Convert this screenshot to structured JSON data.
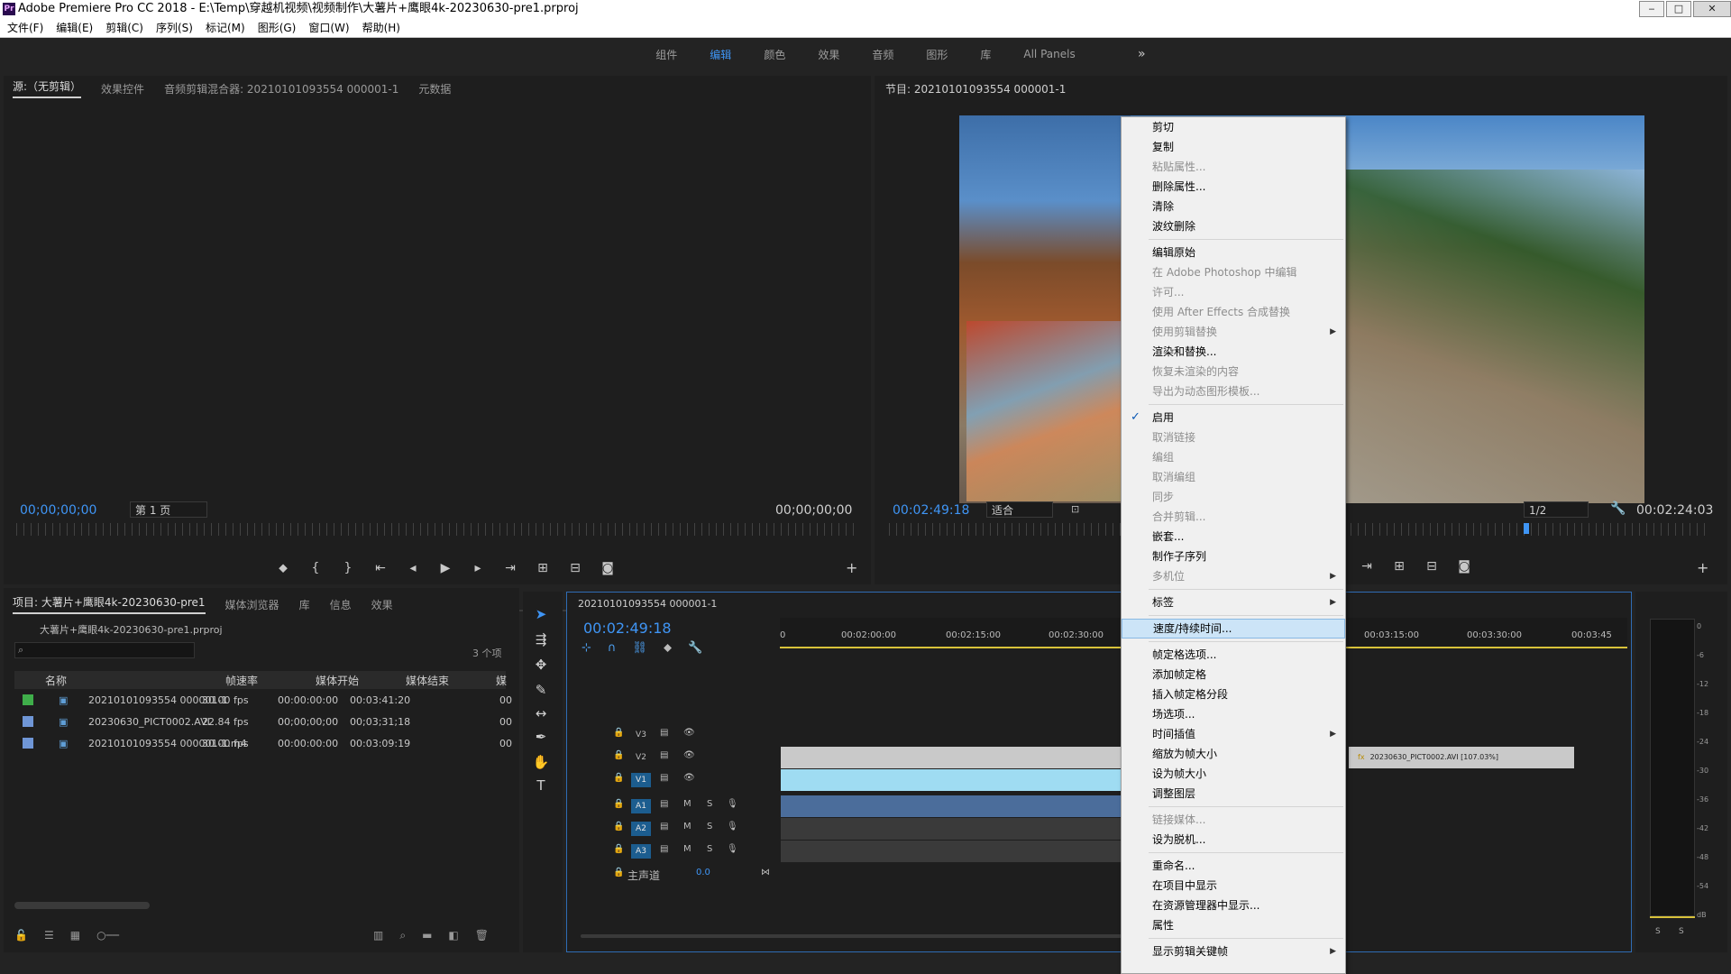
{
  "window": {
    "title": "Adobe Premiere Pro CC 2018 - E:\\Temp\\穿越机视频\\视频制作\\大薯片+鹰眼4k-20230630-pre1.prproj",
    "logo": "Pr"
  },
  "menubar": [
    "文件(F)",
    "编辑(E)",
    "剪辑(C)",
    "序列(S)",
    "标记(M)",
    "图形(G)",
    "窗口(W)",
    "帮助(H)"
  ],
  "workspaces": {
    "items": [
      "组件",
      "编辑",
      "颜色",
      "效果",
      "音频",
      "图形",
      "库",
      "All Panels"
    ],
    "active": "编辑",
    "more": "»"
  },
  "source_panel": {
    "tabs": [
      "源:（无剪辑）",
      "效果控件",
      "音频剪辑混合器: 20210101093554 000001-1",
      "元数据"
    ],
    "timecode_left": "00;00;00;00",
    "page_select": "第 1 页",
    "timecode_right": "00;00;00;00"
  },
  "program_panel": {
    "tab": "节目: 20210101093554 000001-1",
    "timecode_left": "00:02:49:18",
    "fit_select": "适合",
    "resolution_select": "1/2",
    "timecode_right": "00:02:24:03"
  },
  "project_panel": {
    "tabs": [
      "项目: 大薯片+鹰眼4k-20230630-pre1",
      "媒体浏览器",
      "库",
      "信息",
      "效果"
    ],
    "file": "大薯片+鹰眼4k-20230630-pre1.prproj",
    "count": "3 个项",
    "columns": [
      "名称",
      "帧速率",
      "媒体开始",
      "媒体结束",
      "媒"
    ],
    "rows": [
      {
        "color": "#3fae4a",
        "name": "20210101093554 000001-1",
        "fps": "30.00 fps",
        "start": "00:00:00:00",
        "end": "00:03:41:20",
        "extra": "00"
      },
      {
        "color": "#6f96d6",
        "name": "20230630_PICT0002.AVI",
        "fps": "22.84 fps",
        "start": "00;00;00;00",
        "end": "00;03;31;18",
        "extra": "00"
      },
      {
        "color": "#6f96d6",
        "name": "20210101093554 000001-1.m4",
        "fps": "30.00 fps",
        "start": "00:00:00:00",
        "end": "00:03:09:19",
        "extra": "00"
      }
    ]
  },
  "timeline": {
    "tab": "20210101093554 000001-1",
    "timecode": "00:02:49:18",
    "ruler_left": [
      "0",
      "00:02:00:00",
      "00:02:15:00",
      "00:02:30:00"
    ],
    "ruler_right": [
      "00:03:15:00",
      "00:03:30:00",
      "00:03:45"
    ],
    "tracks": [
      "V3",
      "V2",
      "V1",
      "A1",
      "A2",
      "A3"
    ],
    "master_label": "主声道",
    "master_value": "0.0",
    "clip_label": "20230630_PICT0002.AVI [107.03%]",
    "fx": "fx",
    "track_m": "M",
    "track_s": "S"
  },
  "meter": {
    "scale": [
      "0",
      "-6",
      "-12",
      "-18",
      "-24",
      "-30",
      "-36",
      "-42",
      "-48",
      "-54",
      "dB"
    ],
    "solo": [
      "S",
      "S"
    ]
  },
  "context_menu": [
    {
      "label": "剪切"
    },
    {
      "label": "复制"
    },
    {
      "label": "粘贴属性...",
      "disabled": true
    },
    {
      "label": "删除属性..."
    },
    {
      "label": "清除"
    },
    {
      "label": "波纹删除"
    },
    {
      "sep": true
    },
    {
      "label": "编辑原始"
    },
    {
      "label": "在 Adobe Photoshop 中编辑",
      "disabled": true
    },
    {
      "label": "许可...",
      "disabled": true
    },
    {
      "label": "使用 After Effects 合成替换",
      "disabled": true
    },
    {
      "label": "使用剪辑替换",
      "disabled": true,
      "submenu": true
    },
    {
      "label": "渲染和替换..."
    },
    {
      "label": "恢复未渲染的内容",
      "disabled": true
    },
    {
      "label": "导出为动态图形模板...",
      "disabled": true
    },
    {
      "sep": true
    },
    {
      "label": "启用",
      "checked": true
    },
    {
      "label": "取消链接",
      "disabled": true
    },
    {
      "label": "编组",
      "disabled": true
    },
    {
      "label": "取消编组",
      "disabled": true
    },
    {
      "label": "同步",
      "disabled": true
    },
    {
      "label": "合并剪辑...",
      "disabled": true
    },
    {
      "label": "嵌套..."
    },
    {
      "label": "制作子序列"
    },
    {
      "label": "多机位",
      "disabled": true,
      "submenu": true
    },
    {
      "sep": true
    },
    {
      "label": "标签",
      "submenu": true
    },
    {
      "sep": true
    },
    {
      "label": "速度/持续时间...",
      "highlight": true
    },
    {
      "sep": true
    },
    {
      "label": "帧定格选项..."
    },
    {
      "label": "添加帧定格"
    },
    {
      "label": "插入帧定格分段"
    },
    {
      "label": "场选项..."
    },
    {
      "label": "时间插值",
      "submenu": true
    },
    {
      "label": "缩放为帧大小"
    },
    {
      "label": "设为帧大小"
    },
    {
      "label": "调整图层"
    },
    {
      "sep": true
    },
    {
      "label": "链接媒体...",
      "disabled": true
    },
    {
      "label": "设为脱机..."
    },
    {
      "sep": true
    },
    {
      "label": "重命名..."
    },
    {
      "label": "在项目中显示"
    },
    {
      "label": "在资源管理器中显示..."
    },
    {
      "label": "属性"
    },
    {
      "sep": true
    },
    {
      "label": "显示剪辑关键帧",
      "submenu": true
    }
  ],
  "colors": {
    "accent": "#3f95f5",
    "clip_v1": "#9fdcf2",
    "clip_v2": "#c9c9c9",
    "audio_clip": "#4b6d9b"
  }
}
